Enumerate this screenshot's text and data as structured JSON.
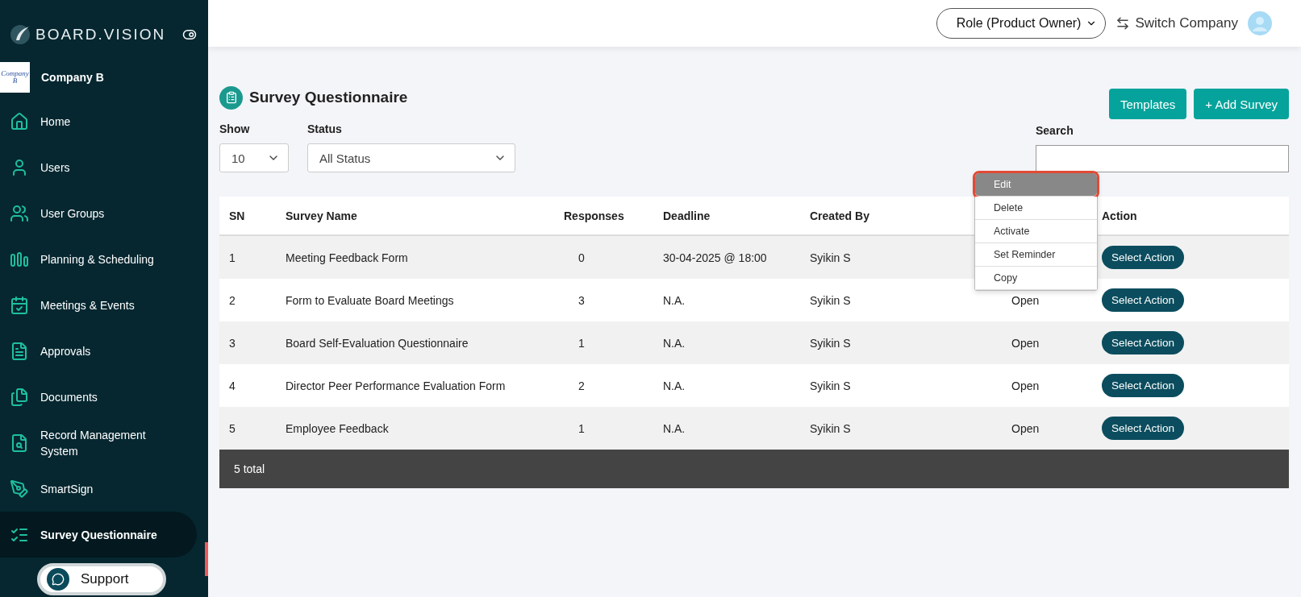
{
  "sidebar": {
    "brand": "BOARD.VISION",
    "company": {
      "logo_text": "Company B",
      "name": "Company B"
    },
    "items": [
      {
        "label": "Home",
        "selected": false
      },
      {
        "label": "Users",
        "selected": false
      },
      {
        "label": "User Groups",
        "selected": false
      },
      {
        "label": "Planning & Scheduling",
        "selected": false
      },
      {
        "label": "Meetings & Events",
        "selected": false
      },
      {
        "label": "Approvals",
        "selected": false
      },
      {
        "label": "Documents",
        "selected": false
      },
      {
        "label": "Record Management System",
        "selected": false
      },
      {
        "label": "SmartSign",
        "selected": false
      },
      {
        "label": "Survey Questionnaire",
        "selected": true
      }
    ]
  },
  "support": {
    "label": "Support"
  },
  "topbar": {
    "role": "Role (Product Owner)",
    "switch": "Switch Company"
  },
  "page": {
    "title": "Survey Questionnaire",
    "buttons": [
      "Templates",
      "+ Add Survey"
    ]
  },
  "filters": {
    "show": {
      "label": "Show",
      "value": "10"
    },
    "status": {
      "label": "Status",
      "value": "All Status"
    },
    "search": {
      "label": "Search"
    }
  },
  "table": {
    "columns": [
      "SN",
      "Survey Name",
      "Responses",
      "Deadline",
      "Created By",
      null,
      "Action"
    ],
    "rows": [
      [
        "1",
        "Meeting Feedback Form",
        "0",
        "30-04-2025 @ 18:00",
        "Syikin S",
        null,
        "Select Action"
      ],
      [
        "2",
        "Form to Evaluate Board Meetings",
        "3",
        "N.A.",
        "Syikin S",
        "Open",
        "Select Action"
      ],
      [
        "3",
        "Board Self-Evaluation Questionnaire",
        "1",
        "N.A.",
        "Syikin S",
        "Open",
        "Select Action"
      ],
      [
        "4",
        "Director Peer Performance Evaluation Form",
        "2",
        "N.A.",
        "Syikin S",
        "Open",
        "Select Action"
      ],
      [
        "5",
        "Employee Feedback",
        "1",
        "N.A.",
        "Syikin S",
        "Open",
        "Select Action"
      ]
    ],
    "footer": "5 total"
  },
  "action_menu": {
    "items": [
      {
        "label": "Edit",
        "selected": true
      },
      {
        "label": "Delete",
        "selected": false
      },
      {
        "label": "Activate",
        "selected": false
      },
      {
        "label": "Set Reminder",
        "selected": false
      },
      {
        "label": "Copy",
        "selected": false
      }
    ]
  }
}
